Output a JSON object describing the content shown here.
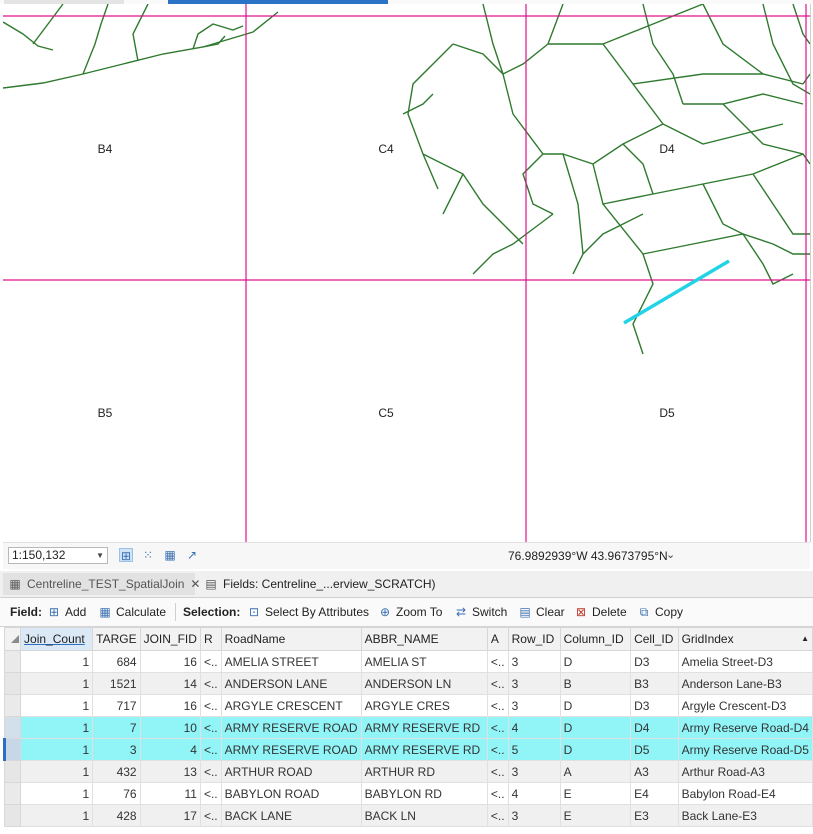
{
  "map": {
    "grid_labels": [
      {
        "text": "B4"
      },
      {
        "text": "C4"
      },
      {
        "text": "D4"
      },
      {
        "text": "B5"
      },
      {
        "text": "C5"
      },
      {
        "text": "D5"
      }
    ],
    "colors": {
      "grid": "#e0118c",
      "roads": "#2f7a2f",
      "selected": "#22d3e6"
    }
  },
  "status": {
    "scale": "1:150,132",
    "coordinates": "76.9892939°W 43.9673795°N"
  },
  "tabs": [
    {
      "label": "Centreline_TEST_SpatialJoin"
    },
    {
      "label": "Fields:  Centreline_...erview_SCRATCH)"
    }
  ],
  "toolbar": {
    "field_label": "Field:",
    "add": "Add",
    "calculate": "Calculate",
    "selection_label": "Selection:",
    "select_by_attributes": "Select By Attributes",
    "zoom_to": "Zoom To",
    "switch": "Switch",
    "clear": "Clear",
    "delete": "Delete",
    "copy": "Copy"
  },
  "table": {
    "columns": [
      "Join_Count",
      "TARGE",
      "JOIN_FID",
      "R",
      "RoadName",
      "ABBR_NAME",
      "A",
      "Row_ID",
      "Column_ID",
      "Cell_ID",
      "GridIndex"
    ],
    "rows": [
      [
        "1",
        "684",
        "16",
        "<..",
        "AMELIA STREET",
        "AMELIA ST",
        "<..",
        "3",
        "D",
        "D3",
        "Amelia Street-D3"
      ],
      [
        "1",
        "1521",
        "14",
        "<..",
        "ANDERSON LANE",
        "ANDERSON LN",
        "<..",
        "3",
        "B",
        "B3",
        "Anderson Lane-B3"
      ],
      [
        "1",
        "717",
        "16",
        "<..",
        "ARGYLE CRESCENT",
        "ARGYLE CRES",
        "<..",
        "3",
        "D",
        "D3",
        "Argyle Crescent-D3"
      ],
      [
        "1",
        "7",
        "10",
        "<..",
        "ARMY RESERVE ROAD",
        "ARMY RESERVE RD",
        "<..",
        "4",
        "D",
        "D4",
        "Army Reserve Road-D4"
      ],
      [
        "1",
        "3",
        "4",
        "<..",
        "ARMY RESERVE ROAD",
        "ARMY RESERVE RD",
        "<..",
        "5",
        "D",
        "D5",
        "Army Reserve Road-D5"
      ],
      [
        "1",
        "432",
        "13",
        "<..",
        "ARTHUR ROAD",
        "ARTHUR RD",
        "<..",
        "3",
        "A",
        "A3",
        "Arthur Road-A3"
      ],
      [
        "1",
        "76",
        "11",
        "<..",
        "BABYLON ROAD",
        "BABYLON RD",
        "<..",
        "4",
        "E",
        "E4",
        "Babylon Road-E4"
      ],
      [
        "1",
        "428",
        "17",
        "<..",
        "BACK LANE",
        "BACK LN",
        "<..",
        "3",
        "E",
        "E3",
        "Back Lane-E3"
      ]
    ],
    "highlighted_rows": [
      3,
      4
    ],
    "current_row": 4
  }
}
